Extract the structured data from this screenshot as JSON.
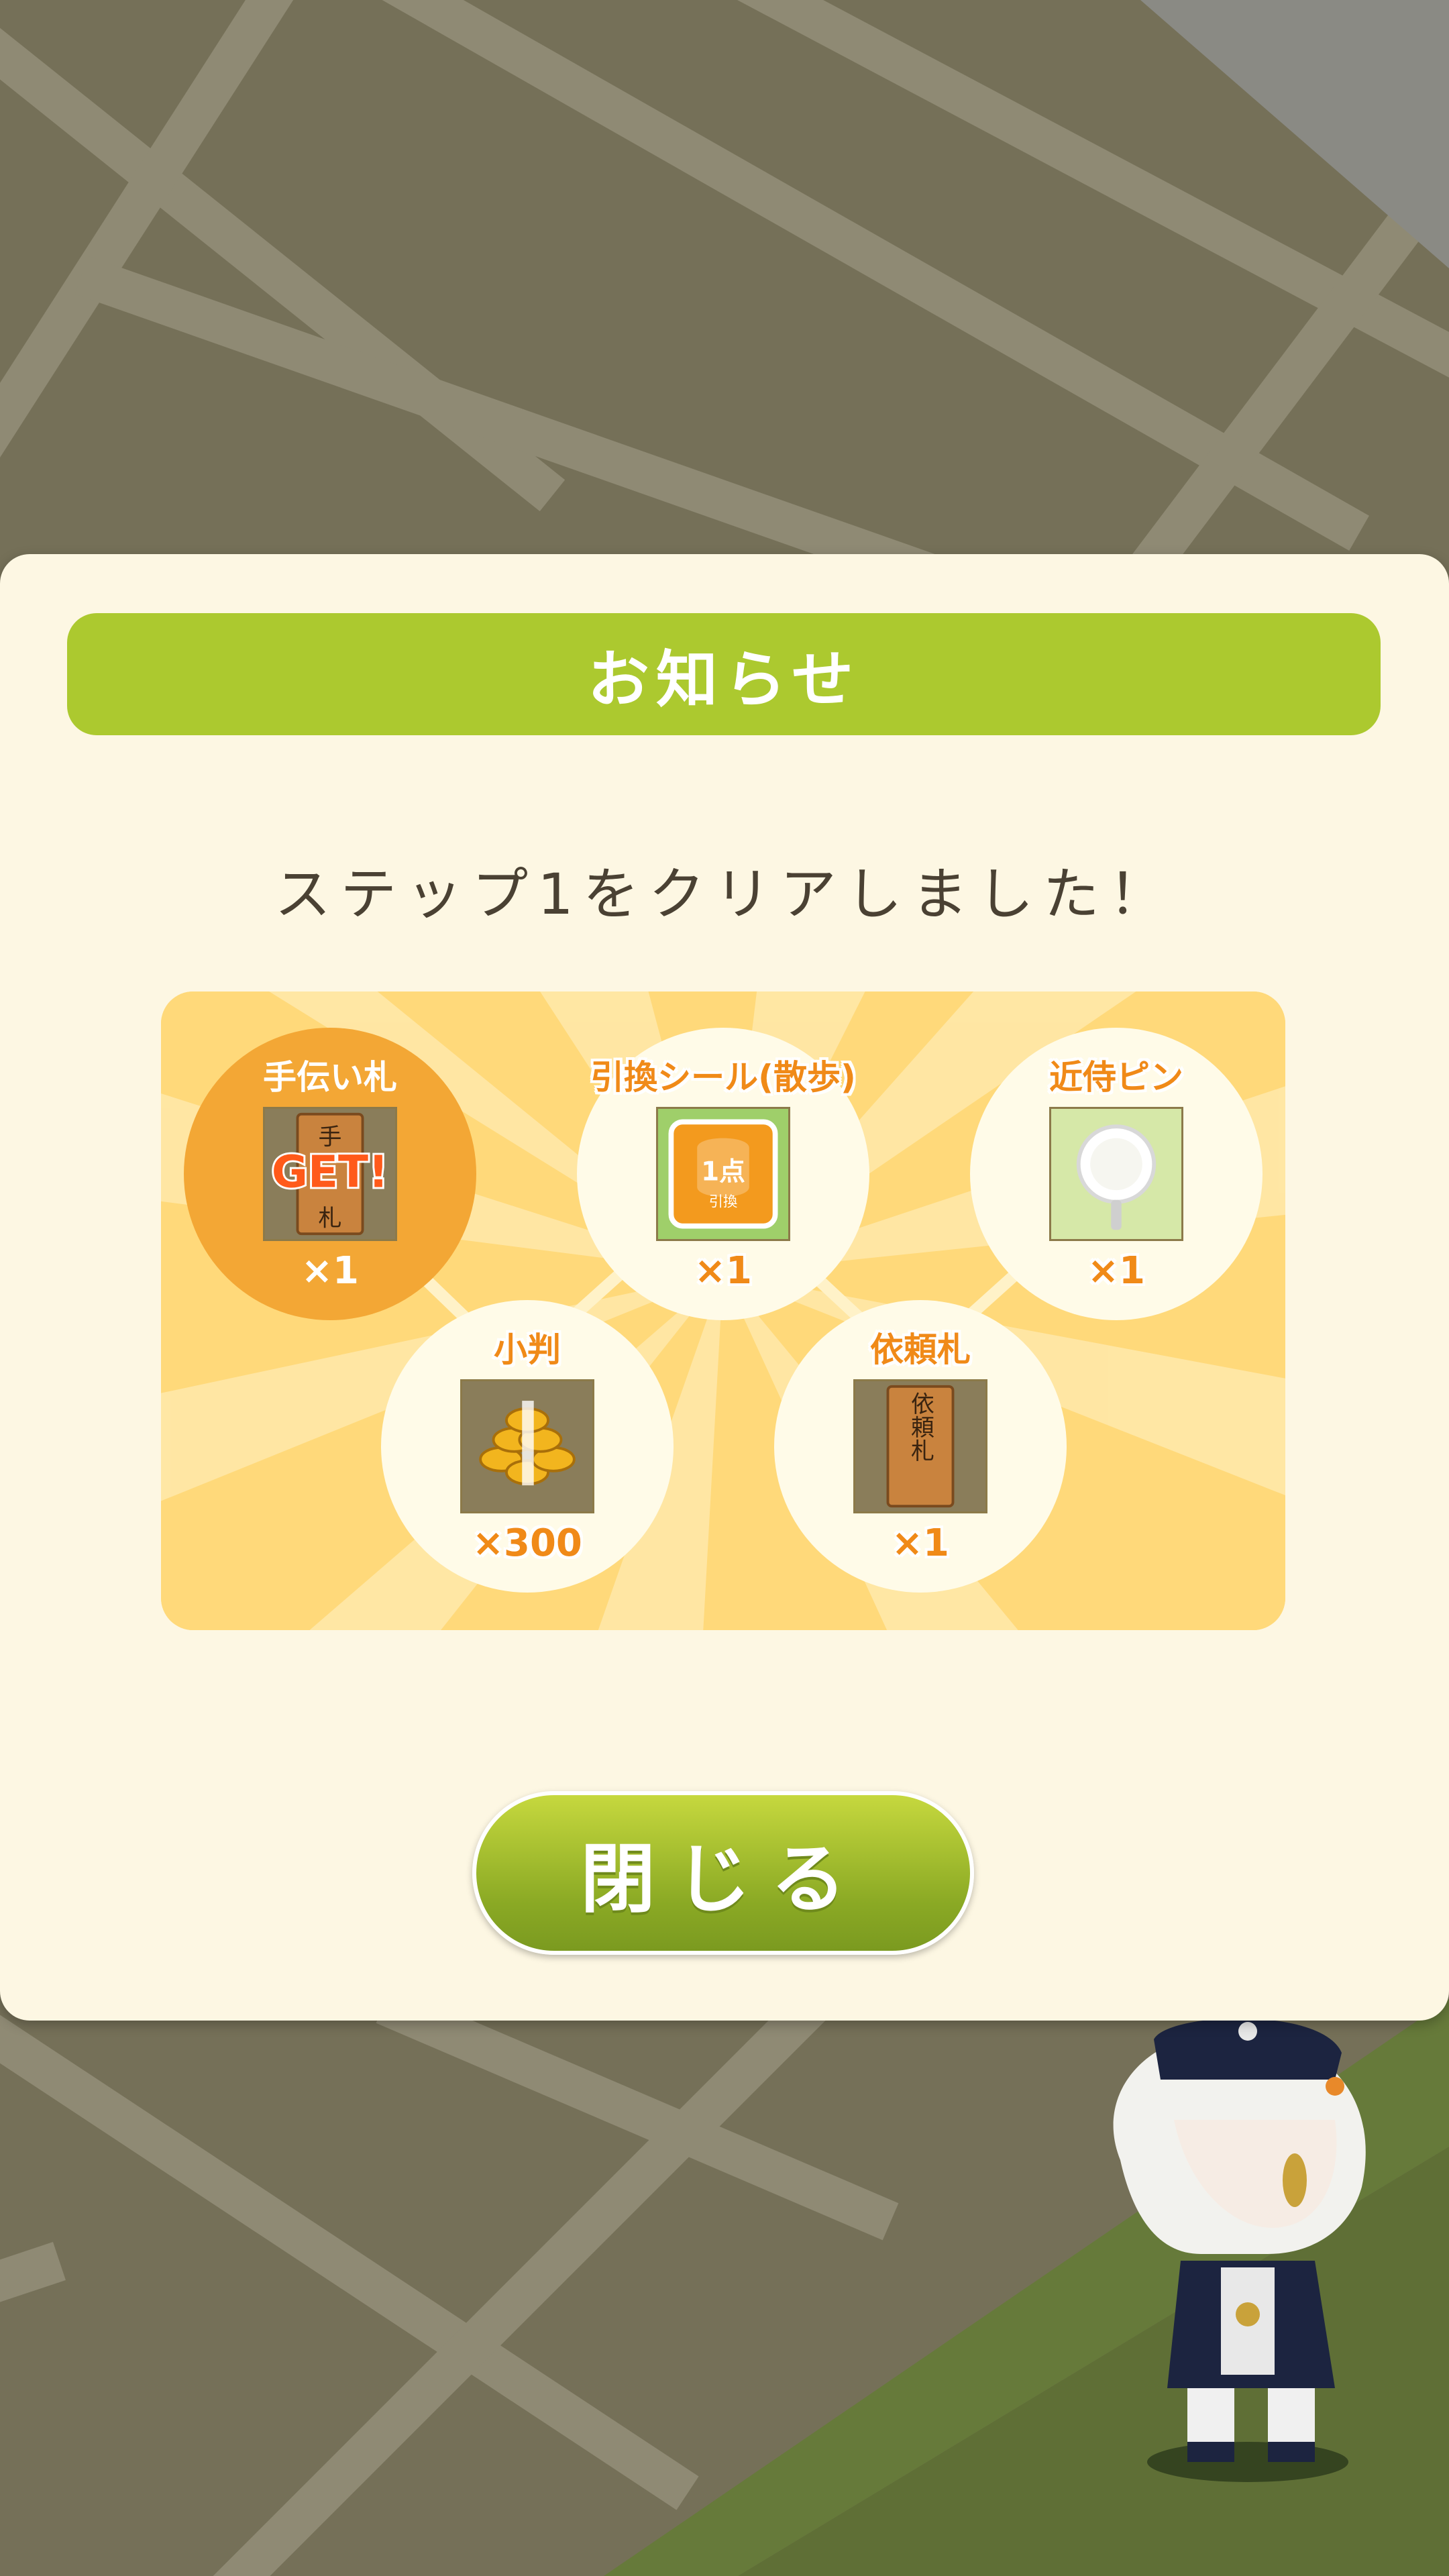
{
  "dialog": {
    "title": "お知らせ",
    "message": "ステップ1をクリアしました！",
    "close_label": "閉じる"
  },
  "rewards": [
    {
      "name": "手伝い札",
      "quantity": "×1",
      "got": true,
      "icon": "tetsudai-fuda-icon",
      "overlay": "GET!"
    },
    {
      "name": "引換シール(散歩)",
      "quantity": "×1",
      "got": false,
      "icon": "exchange-seal-icon"
    },
    {
      "name": "近侍ピン",
      "quantity": "×1",
      "got": false,
      "icon": "kinji-pin-icon"
    },
    {
      "name": "小判",
      "quantity": "×300",
      "got": false,
      "icon": "koban-icon"
    },
    {
      "name": "依頼札",
      "quantity": "×1",
      "got": false,
      "icon": "irai-fuda-icon"
    }
  ],
  "icon_text": {
    "tetsudai_top": "手",
    "tetsudai_bottom": "札",
    "seal_top": "1点",
    "seal_bottom": "引換",
    "irai": "依頼札"
  },
  "colors": {
    "title_bar": "#acc92f",
    "dialog_bg": "#fdf7e3",
    "panel_bg": "#ffd97a",
    "accent_orange": "#f08a18",
    "got_circle": "#f3a735",
    "close_button": "#8aa924"
  }
}
